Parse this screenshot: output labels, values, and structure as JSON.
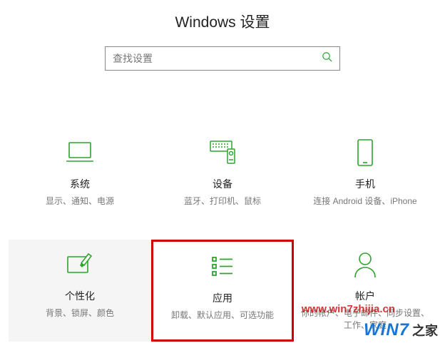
{
  "header": {
    "title": "Windows 设置"
  },
  "search": {
    "placeholder": "查找设置",
    "icon": "search-icon"
  },
  "tiles": [
    {
      "id": "system",
      "title": "系统",
      "desc": "显示、通知、电源",
      "icon": "laptop-icon"
    },
    {
      "id": "devices",
      "title": "设备",
      "desc": "蓝牙、打印机、鼠标",
      "icon": "devices-icon"
    },
    {
      "id": "phone",
      "title": "手机",
      "desc": "连接 Android 设备、iPhone",
      "icon": "phone-icon"
    },
    {
      "id": "personalization",
      "title": "个性化",
      "desc": "背景、锁屏、颜色",
      "icon": "personalization-icon"
    },
    {
      "id": "apps",
      "title": "应用",
      "desc": "卸载、默认应用、可选功能",
      "icon": "apps-icon"
    },
    {
      "id": "accounts",
      "title": "帐户",
      "desc": "你的帐户、电子邮件、同步设置、工作、家庭",
      "icon": "account-icon"
    }
  ],
  "watermarks": {
    "url": "www.win7zhijia.cn",
    "brand_main": "WIN7",
    "brand_sub": "之家"
  },
  "colors": {
    "accent": "#2ca52c",
    "highlight_border": "#d00000"
  }
}
